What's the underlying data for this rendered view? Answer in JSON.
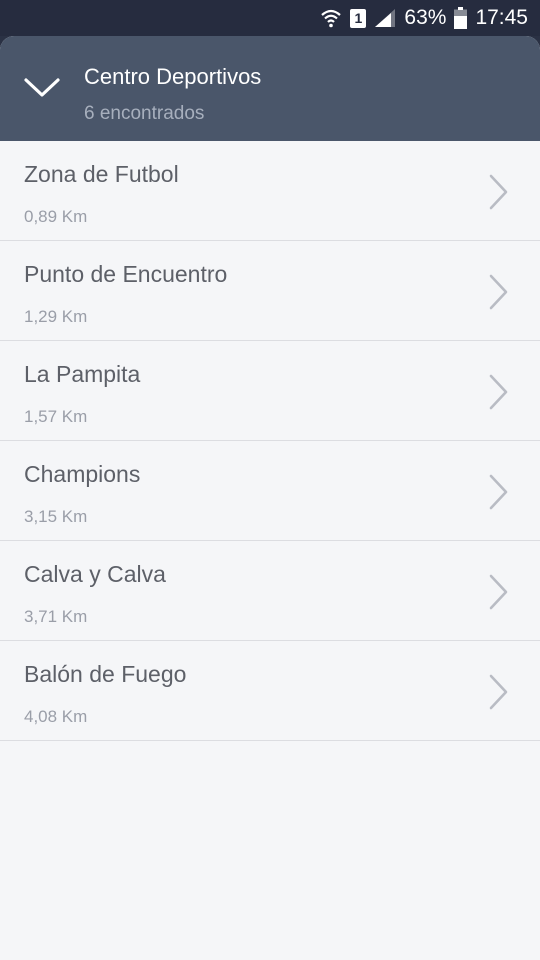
{
  "status_bar": {
    "battery": "63%",
    "time": "17:45",
    "sim": "1"
  },
  "header": {
    "title": "Centro Deportivos",
    "subtitle": "6 encontrados"
  },
  "items": [
    {
      "name": "Zona de Futbol",
      "distance": "0,89 Km"
    },
    {
      "name": "Punto de Encuentro",
      "distance": "1,29 Km"
    },
    {
      "name": "La Pampita",
      "distance": "1,57 Km"
    },
    {
      "name": "Champions",
      "distance": "3,15 Km"
    },
    {
      "name": "Calva y Calva",
      "distance": "3,71 Km"
    },
    {
      "name": "Balón de Fuego",
      "distance": "4,08 Km"
    }
  ],
  "icons": {
    "collapse": "chevron-down-icon",
    "item": "chevron-right-icon",
    "wifi": "wifi-icon",
    "signal": "signal-icon",
    "battery": "battery-icon"
  },
  "colors": {
    "header_bg": "#4a566a",
    "status_bg": "#262c3f",
    "list_bg": "#f5f6f8"
  }
}
